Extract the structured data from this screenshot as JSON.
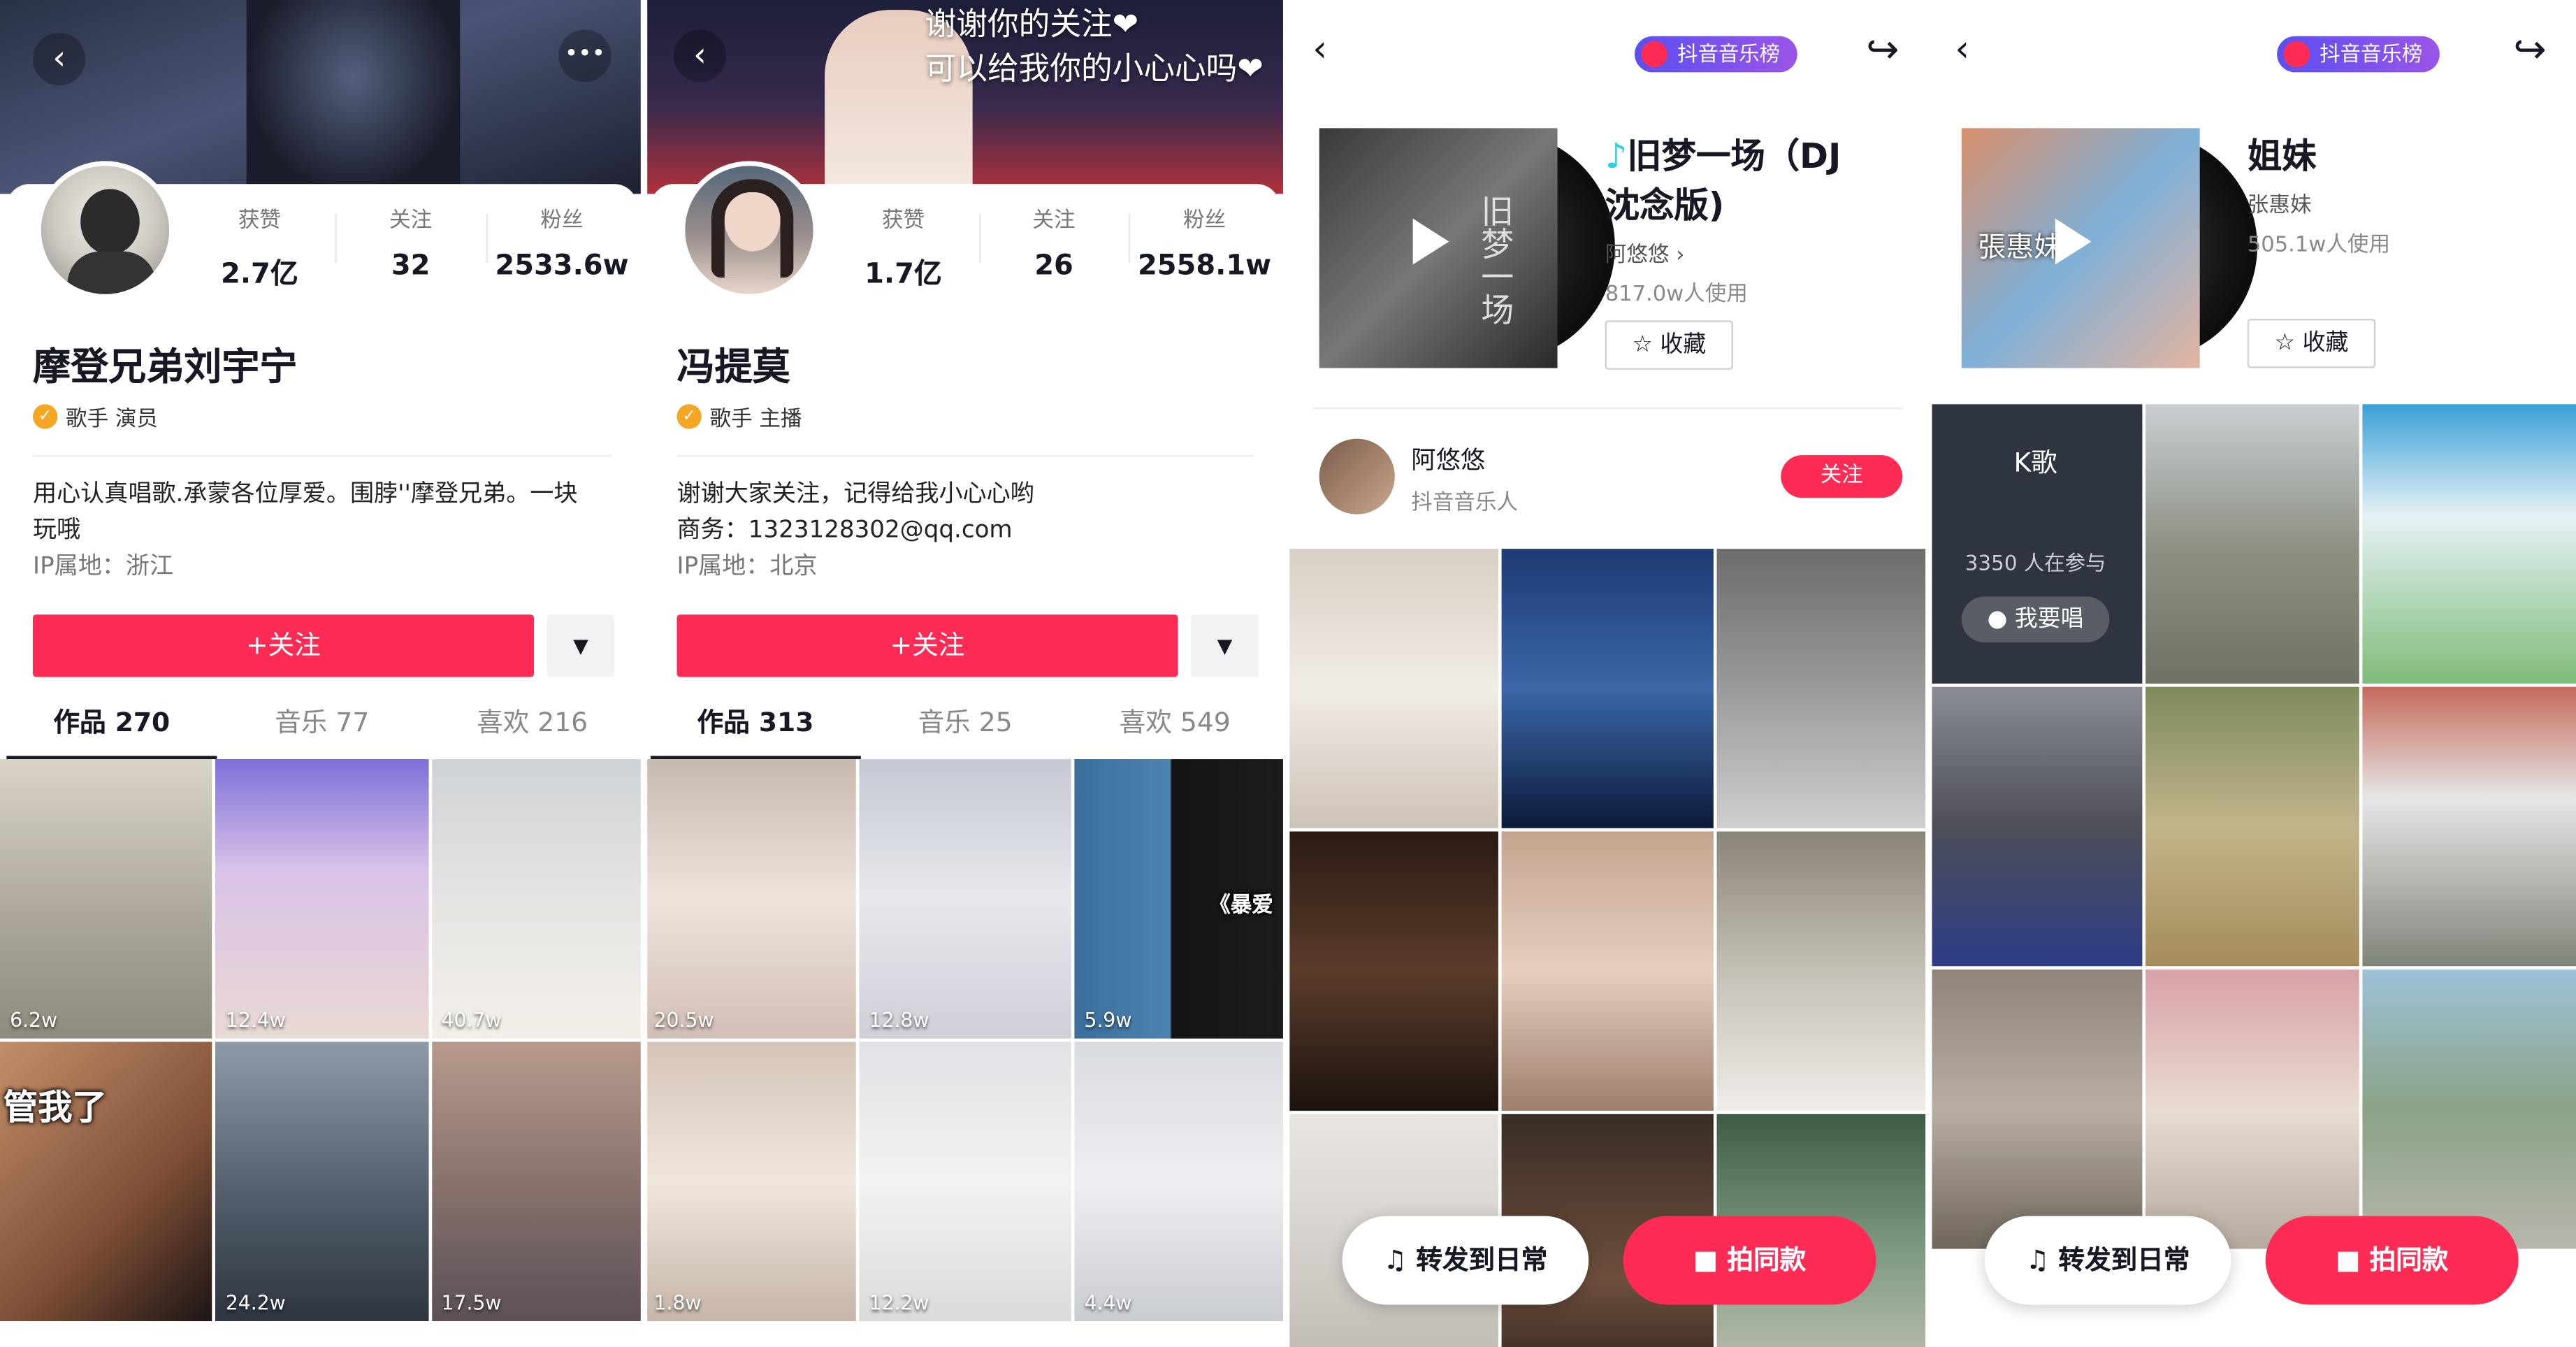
{
  "panels": [
    {
      "name": "摩登兄弟刘宇宁",
      "tags": "歌手 演员",
      "stats": [
        {
          "label": "获赞",
          "value": "2.7亿"
        },
        {
          "label": "关注",
          "value": "32"
        },
        {
          "label": "粉丝",
          "value": "2533.6w"
        }
      ],
      "bio_line1": "用心认真唱歌.承蒙各位厚爱。围脖''摩登兄弟。一块",
      "bio_line2": "玩哦",
      "ip": "IP属地：浙江",
      "follow_label": "+关注",
      "dropdown_icon": "▼",
      "tabs": [
        "作品 270",
        "音乐 77",
        "喜欢 216"
      ],
      "videos": [
        {
          "likes": "6.2w"
        },
        {
          "likes": "12.4w"
        },
        {
          "likes": "40.7w"
        },
        {
          "likes": "",
          "text": "管我了"
        },
        {
          "likes": "24.2w"
        },
        {
          "likes": "17.5w"
        }
      ]
    },
    {
      "name": "冯提莫",
      "tags": "歌手  主播",
      "stats": [
        {
          "label": "获赞",
          "value": "1.7亿"
        },
        {
          "label": "关注",
          "value": "26"
        },
        {
          "label": "粉丝",
          "value": "2558.1w"
        }
      ],
      "cover_caption_1": "谢谢你的关注❤",
      "cover_caption_2": "可以给我你的小心心吗❤",
      "bio_line1": "谢谢大家关注，记得给我小心心哟",
      "bio_line2": "商务：1323128302@qq.com",
      "ip": "IP属地：北京",
      "follow_label": "+关注",
      "dropdown_icon": "▼",
      "tabs": [
        "作品 313",
        "音乐 25",
        "喜欢 549"
      ],
      "videos": [
        {
          "likes": "20.5w"
        },
        {
          "likes": "12.8w"
        },
        {
          "likes": "5.9w",
          "text": "《暴爱"
        },
        {
          "likes": "1.8w"
        },
        {
          "likes": "12.2w"
        },
        {
          "likes": "4.4w"
        }
      ]
    }
  ],
  "music": [
    {
      "badge": "抖音音乐榜",
      "title_line1": "旧梦一场（DJ",
      "title_line2": "沈念版)",
      "title_note": "♪",
      "artist": "阿悠悠 ›",
      "usage": "817.0w人使用",
      "fav_label": "☆ 收藏",
      "artist_name": "阿悠悠",
      "artist_role": "抖音音乐人",
      "artist_follow": "关注",
      "forward_label": "♫  转发到日常",
      "shoot_label": "■  拍同款",
      "album_text": "旧梦一场"
    },
    {
      "badge": "抖音音乐榜",
      "title_line1": "姐妹",
      "artist": "张惠妹",
      "usage": "505.1w人使用",
      "fav_label": "☆ 收藏",
      "karaoke_title": "K歌",
      "karaoke_count": "3350 人在参与",
      "karaoke_button": "● 我要唱",
      "forward_label": "♫  转发到日常",
      "shoot_label": "■  拍同款",
      "album_text": "張惠妹"
    }
  ],
  "icons": {
    "back": "‹",
    "share": "↪",
    "more": "•••"
  },
  "colors": {
    "accent": "#fe2c55",
    "text": "#161823"
  }
}
